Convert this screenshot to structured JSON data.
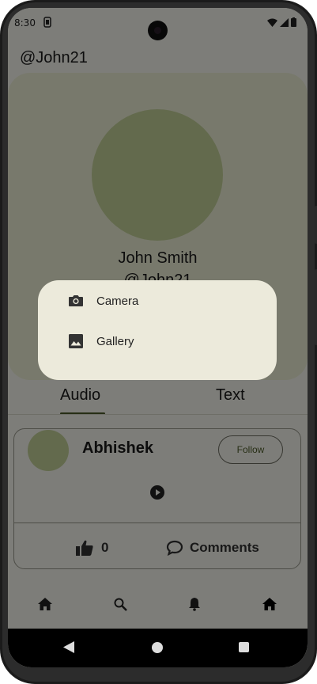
{
  "status_bar": {
    "time": "8:30"
  },
  "profile": {
    "username_header": "@John21",
    "name": "John Smith",
    "handle": "@John21"
  },
  "tabs": [
    {
      "label": "Audio",
      "selected": true
    },
    {
      "label": "Text",
      "selected": false
    }
  ],
  "post": {
    "author": "Abhishek",
    "follow_label": "Follow",
    "likes": "0",
    "comments_label": "Comments"
  },
  "bottom_nav": [
    {
      "icon": "home-icon"
    },
    {
      "icon": "search-icon"
    },
    {
      "icon": "bell-icon"
    },
    {
      "icon": "home-icon",
      "selected": true
    }
  ],
  "dialog": {
    "options": [
      {
        "icon": "camera-icon",
        "label": "Camera"
      },
      {
        "icon": "image-icon",
        "label": "Gallery"
      }
    ]
  },
  "colors": {
    "accent": "#4f5d2a",
    "avatar": "#c6d59a",
    "card_background": "#f0f2d9",
    "dialog_background": "#eceadb",
    "scrim": "rgba(0,0,0,0.5)"
  }
}
